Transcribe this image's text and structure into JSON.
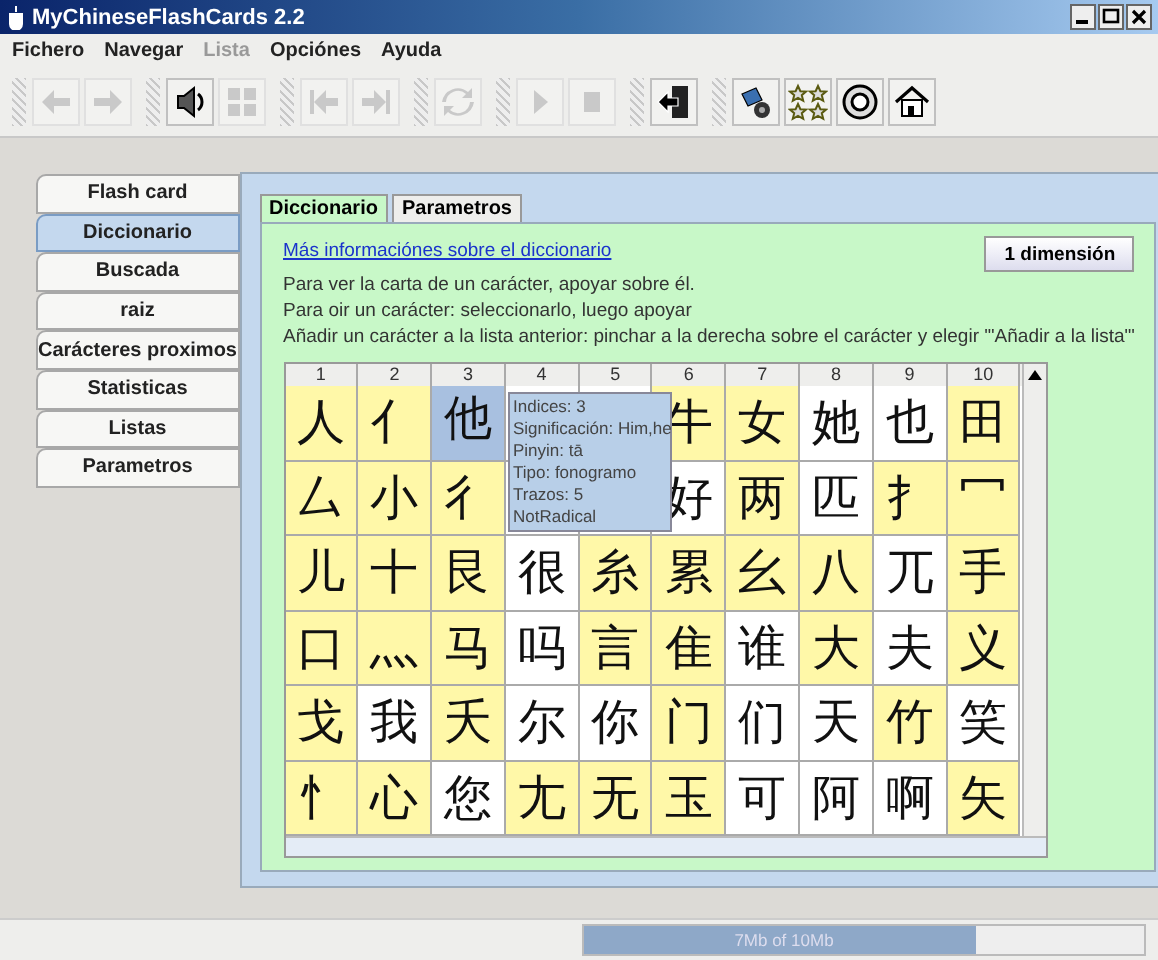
{
  "window": {
    "title": "MyChineseFlashCards 2.2"
  },
  "menu": [
    {
      "label": "Fichero",
      "disabled": false
    },
    {
      "label": "Navegar",
      "disabled": false
    },
    {
      "label": "Lista",
      "disabled": true
    },
    {
      "label": "Opciónes",
      "disabled": false
    },
    {
      "label": "Ayuda",
      "disabled": false
    }
  ],
  "toolbar": [
    [
      {
        "kind": "back",
        "disabled": true
      },
      {
        "kind": "forward",
        "disabled": true
      }
    ],
    [
      {
        "kind": "speaker",
        "disabled": false
      },
      {
        "kind": "grid",
        "disabled": true
      }
    ],
    [
      {
        "kind": "first",
        "disabled": true
      },
      {
        "kind": "last",
        "disabled": true
      }
    ],
    [
      {
        "kind": "refresh",
        "disabled": true
      }
    ],
    [
      {
        "kind": "play",
        "disabled": true
      },
      {
        "kind": "stop",
        "disabled": true
      }
    ],
    [
      {
        "kind": "exit",
        "disabled": false
      }
    ],
    [
      {
        "kind": "settings",
        "disabled": false
      },
      {
        "kind": "stars",
        "disabled": false
      },
      {
        "kind": "help",
        "disabled": false
      },
      {
        "kind": "home",
        "disabled": false
      }
    ]
  ],
  "sidebar": {
    "items": [
      {
        "label": "Flash card",
        "selected": false
      },
      {
        "label": "Diccionario",
        "selected": true
      },
      {
        "label": "Buscada",
        "selected": false
      },
      {
        "label": "raiz",
        "selected": false
      },
      {
        "label": "Carácteres proximos",
        "selected": false
      },
      {
        "label": "Statisticas",
        "selected": false
      },
      {
        "label": "Listas",
        "selected": false
      },
      {
        "label": "Parametros",
        "selected": false
      }
    ]
  },
  "tabs": [
    {
      "label": "Diccionario",
      "selected": true
    },
    {
      "label": "Parametros",
      "selected": false
    }
  ],
  "dictionary": {
    "link": "Más informaciónes sobre el diccionario",
    "button": "1 dimensión",
    "instructions": [
      "Para ver la carta de un carácter, apoyar sobre él.",
      "Para oir un carácter: seleccionarlo, luego apoyar",
      "Añadir  un carácter a la lista anterior: pinchar a la derecha sobre el carácter y elegir '\"Añadir a la lista\"'"
    ],
    "columns": [
      "1",
      "2",
      "3",
      "4",
      "5",
      "6",
      "7",
      "8",
      "9",
      "10"
    ],
    "rows": [
      [
        {
          "char": "人",
          "highlight": true,
          "selected": false
        },
        {
          "char": "亻",
          "highlight": true,
          "selected": false
        },
        {
          "char": "他",
          "selected": true
        },
        {},
        {},
        {
          "char": "牛",
          "highlight": true,
          "selected": false
        },
        {
          "char": "女",
          "highlight": true,
          "selected": false
        },
        {
          "char": "她",
          "highlight": false,
          "selected": false
        },
        {
          "char": "也",
          "highlight": false,
          "selected": false
        },
        {
          "char": "田",
          "highlight": true,
          "selected": false
        }
      ],
      [
        {
          "char": "厶",
          "highlight": true,
          "selected": false
        },
        {
          "char": "小",
          "highlight": true,
          "selected": false
        },
        {
          "char": "彳",
          "highlight": true,
          "selected": false
        },
        {},
        {},
        {
          "char": "好",
          "highlight": false,
          "selected": false
        },
        {
          "char": "两",
          "highlight": true,
          "selected": false
        },
        {
          "char": "匹",
          "highlight": false,
          "selected": false
        },
        {
          "char": "扌",
          "highlight": true,
          "selected": false
        },
        {
          "char": "冖",
          "highlight": true,
          "selected": false
        }
      ],
      [
        {
          "char": "儿",
          "highlight": true,
          "selected": false
        },
        {
          "char": "十",
          "highlight": true,
          "selected": false
        },
        {
          "char": "艮",
          "highlight": true,
          "selected": false
        },
        {
          "char": "很",
          "highlight": false,
          "selected": false
        },
        {
          "char": "糸",
          "highlight": true,
          "selected": false
        },
        {
          "char": "累",
          "highlight": true,
          "selected": false
        },
        {
          "char": "幺",
          "highlight": true,
          "selected": false
        },
        {
          "char": "八",
          "highlight": true,
          "selected": false
        },
        {
          "char": "兀",
          "highlight": false,
          "selected": false
        },
        {
          "char": "手",
          "highlight": true,
          "selected": false
        }
      ],
      [
        {
          "char": "口",
          "highlight": true,
          "selected": false
        },
        {
          "char": "灬",
          "highlight": true,
          "selected": false
        },
        {
          "char": "马",
          "highlight": true,
          "selected": false
        },
        {
          "char": "吗",
          "highlight": false,
          "selected": false
        },
        {
          "char": "言",
          "highlight": true,
          "selected": false
        },
        {
          "char": "隹",
          "highlight": true,
          "selected": false
        },
        {
          "char": "谁",
          "highlight": false,
          "selected": false
        },
        {
          "char": "大",
          "highlight": true,
          "selected": false
        },
        {
          "char": "夫",
          "highlight": false,
          "selected": false
        },
        {
          "char": "义",
          "highlight": true,
          "selected": false
        }
      ],
      [
        {
          "char": "戈",
          "highlight": true,
          "selected": false
        },
        {
          "char": "我",
          "highlight": false,
          "selected": false
        },
        {
          "char": "夭",
          "highlight": true,
          "selected": false
        },
        {
          "char": "尔",
          "highlight": false,
          "selected": false
        },
        {
          "char": "你",
          "highlight": false,
          "selected": false
        },
        {
          "char": "门",
          "highlight": true,
          "selected": false
        },
        {
          "char": "们",
          "highlight": false,
          "selected": false
        },
        {
          "char": "天",
          "highlight": false,
          "selected": false
        },
        {
          "char": "竹",
          "highlight": true,
          "selected": false
        },
        {
          "char": "笑",
          "highlight": false,
          "selected": false
        }
      ],
      [
        {
          "char": "忄",
          "highlight": true,
          "selected": false
        },
        {
          "char": "心",
          "highlight": true,
          "selected": false
        },
        {
          "char": "您",
          "highlight": false,
          "selected": false
        },
        {
          "char": "尢",
          "highlight": true,
          "selected": false
        },
        {
          "char": "无",
          "highlight": true,
          "selected": false
        },
        {
          "char": "玉",
          "highlight": true,
          "selected": false
        },
        {
          "char": "可",
          "highlight": false,
          "selected": false
        },
        {
          "char": "阿",
          "highlight": false,
          "selected": false
        },
        {
          "char": "啊",
          "highlight": false,
          "selected": false
        },
        {
          "char": "矢",
          "highlight": true,
          "selected": false
        }
      ]
    ],
    "tooltip": [
      "Indices: 3",
      "Significación: Him,he",
      "Pinyin: tā",
      "Tipo: fonogramo",
      "Trazos: 5",
      "NotRadical"
    ]
  },
  "status_bar": {
    "memory": {
      "level": 0.7,
      "reading": "7Mb of 10Mb"
    }
  }
}
